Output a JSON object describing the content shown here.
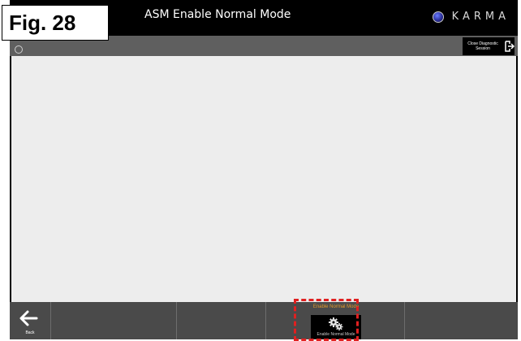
{
  "figure_label": "Fig. 28",
  "window": {
    "title": "ASM Enable Normal Mode",
    "brand": "KARMA"
  },
  "toolbar": {
    "close_session_label": "Close Diagnostic Session"
  },
  "bottom_bar": {
    "back_label": "Back",
    "enable_normal_mode_header": "Enable Normal Mode",
    "enable_normal_mode_button_label": "Enable Normal Mode"
  },
  "icons": [
    "karma-logo-icon",
    "exit-icon",
    "back-arrow-icon",
    "gears-icon"
  ],
  "colors": {
    "header_label": "#e39a2c",
    "highlight": "#e02020",
    "toolbar": "#5f5f5f",
    "bottom_bar": "#4a4a4a"
  }
}
